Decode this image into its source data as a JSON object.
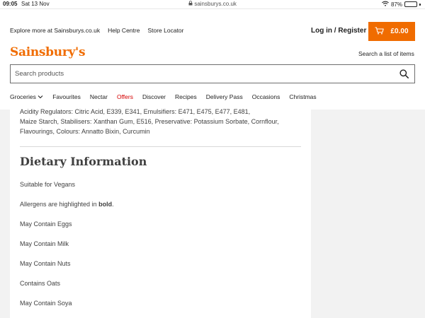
{
  "status_bar": {
    "time": "09:05",
    "date": "Sat 13 Nov",
    "url": "sainsburys.co.uk",
    "battery": "87%",
    "battery_level": 0.87
  },
  "header": {
    "links": [
      "Explore more at Sainsburys.co.uk",
      "Help Centre",
      "Store Locator"
    ],
    "login": "Log in / Register",
    "basket_total": "£0.00",
    "logo": "Sainsbury's",
    "search_list": "Search a list of items",
    "search_placeholder": "Search products"
  },
  "nav": {
    "items": [
      "Groceries",
      "Favourites",
      "Nectar",
      "Offers",
      "Discover",
      "Recipes",
      "Delivery Pass",
      "Occasions",
      "Christmas"
    ]
  },
  "content": {
    "ingredients_lines": [
      "Acidity Regulators: Citric Acid, E339, E341, Emulsifiers: E471, E475, E477, E481,",
      "Maize Starch, Stabilisers: Xanthan Gum, E516, Preservative: Potassium Sorbate, Cornflour,",
      "Flavourings, Colours: Annatto Bixin, Curcumin"
    ],
    "dietary_title": "Dietary Information",
    "vegan": "Suitable for Vegans",
    "allergen_prefix": "Allergens are highlighted in ",
    "allergen_bold": "bold",
    "allergen_suffix": ".",
    "allergens": [
      "May Contain Eggs",
      "May Contain Milk",
      "May Contain Nuts",
      "Contains Oats",
      "May Contain Soya"
    ]
  },
  "colors": {
    "brand_orange": "#f06c00",
    "offers_red": "#d50000"
  }
}
